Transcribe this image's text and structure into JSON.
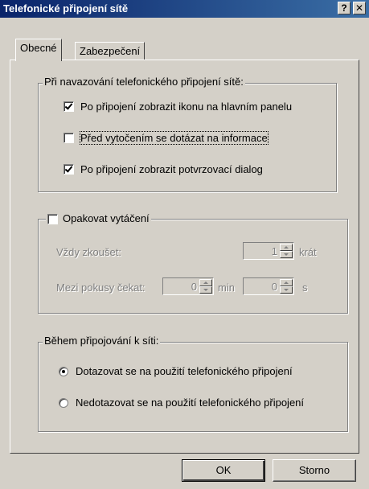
{
  "window": {
    "title": "Telefonické připojení sítě",
    "help_btn": "?",
    "close_btn": "✕"
  },
  "tabs": [
    {
      "label": "Obecné",
      "active": true
    },
    {
      "label": "Zabezpečení",
      "active": false
    }
  ],
  "group_connect": {
    "legend": "Při navazování telefonického připojení sítě:",
    "options": [
      {
        "label": "Po připojení zobrazit ikonu na hlavním panelu",
        "checked": true
      },
      {
        "label": "Před vytočením se dotázat na informace",
        "checked": false
      },
      {
        "label": "Po připojení zobrazit potvrzovací dialog",
        "checked": true
      }
    ]
  },
  "group_redial": {
    "legend": "Opakovat vytáčení",
    "checked": false,
    "always_try_label": "Vždy zkoušet:",
    "always_try_value": "1",
    "always_try_unit": "krát",
    "wait_label": "Mezi pokusy čekat:",
    "wait_min_value": "0",
    "wait_min_unit": "min",
    "wait_sec_value": "0",
    "wait_sec_unit": "s"
  },
  "group_during": {
    "legend": "Během připojování k síti:",
    "options": [
      {
        "label": "Dotazovat se na použití telefonického připojení",
        "selected": true
      },
      {
        "label": "Nedotazovat se na použití telefonického připojení",
        "selected": false
      }
    ]
  },
  "buttons": {
    "ok": "OK",
    "cancel": "Storno"
  }
}
